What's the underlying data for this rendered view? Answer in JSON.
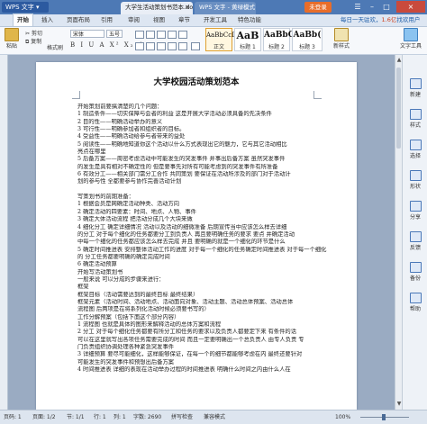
{
  "titlebar": {
    "app_name": "WPS 文字",
    "tabs": [
      {
        "label": "大学生活动策划书范本.doc *",
        "active": true
      },
      {
        "label": "WPS 文字 - 黄绿模式",
        "active": false
      }
    ],
    "login_label": "未登录",
    "controls": {
      "minimize": "–",
      "maximize": "□",
      "close": "×"
    }
  },
  "menubar": {
    "items": [
      "开始",
      "插入",
      "页面布局",
      "引用",
      "审阅",
      "视图",
      "章节",
      "开发工具",
      "特色功能"
    ],
    "promo_prefix": "每日一天驻欢，",
    "promo_highlight": "1.6亿",
    "promo_suffix": "找欢用户"
  },
  "ribbon": {
    "paste_label": "粘贴",
    "cut_label": "剪切",
    "copy_label": "复制",
    "format_painter_label": "格式刷",
    "font_name": "宋体",
    "font_size": "五号",
    "format_glyphs": "B I U A X² X₂ A",
    "styles": [
      {
        "sample": "AaBbCcDd",
        "name": "正文"
      },
      {
        "sample": "AaB",
        "name": "标题 1"
      },
      {
        "sample": "AaBbC",
        "name": "标题 2"
      },
      {
        "sample": "AaBb(",
        "name": "标题 3"
      }
    ],
    "new_style_label": "新样式",
    "text_tools_label": "文字工具"
  },
  "document": {
    "title": "大学校园活动策划范本",
    "lines": [
      "开始策划前要搞清楚的几个问题：",
      "1 制造条件——切实保障与会者的利益 这是开展大学活动必须具备的先决条件",
      "2 目的性——明确活动举办的意义",
      "3 可行性——明确参加者和组织者的目标。",
      "4 受益性——明确活动给参与者带来的益处",
      "5 阅读性——明确地知道你这个活动以什么方式表现出它的魅力，它与其它活动相比",
      "亮点在哪里",
      "5 后备方案——周密考虑活动中可能发生的突发事件 并事出后备方案 虽然突发事件",
      "的发生是具有相对不确定性的 但是要事先对所有可能考虑到的突发事件有所准备",
      "6 有效分工——相关部门需分工合作 共同策划 要保证在活动所涉及的部门对于活动计",
      "划的参与性 全都要参与协作完善活动计划",
      "",
      "写策划书的前期准备：",
      "1 根据会员是网确定活动种类、活动方向",
      "2 确定活动的四要素：时间、地点、人物、事件",
      "3 确定大体活动流程 把活动分成几个大块来做",
      "4 细化分工 确定详细情况 活动以及活动的细微准备 后期宣传当中应该怎么样去详细",
      "的分工 对于每个细化的任务都要分工到负责人 再且要明确任务的要求 要点 并确定活动",
      "中每一个细化的任务都应该怎么样去完成 并且 要明确的就是一个细化的环节是什么",
      "5 确定时间推进表 安排整体活动工作的进度 对于每一个细化的任务确定时间推进表 对于每一个细化",
      "的 分工任务都要明确的确定完成时间",
      "6 确定活动预算",
      "开始写活动策划书",
      "一般来说 可以分成的步骤来进行：",
      "框架",
      "框架目标（活动需要达到的最终目标 最终结果）",
      "框架元素（活动时间、活动地点、活动面向对象、活动主题、活动总体预案、活动总体",
      "流程图 后两项是在将系列化活动时候必须要书写的）",
      "工作分解预案（包括下面这个部分内容）",
      "1 流程图 也就是具体的图形来解释活动的总体方案和流程",
      "2 分工 对于每个细化任务都要有所分工和任务的要求以及负责人都要定下来 有条件的话",
      "可以在这里就写出各项任务需要完成的时间 而且一定要明确出一个总负责人 由专人负责 专",
      "门负责组织协调处理各种紧急突发事件",
      "3 详细预算 要尽可能细化，这样能够保证，在每一个的细节都能够考虑在内 最终还要针对",
      "可能发生的突发事件和预想出后备方案",
      "4 时间推进表 详细的表现在活动举办过程的时间推进表 明确什么时间之内由什么人在"
    ]
  },
  "sidebar": {
    "items": [
      "新建",
      "样式",
      "选择",
      "形状",
      "分享",
      "反馈",
      "备份",
      "帮助"
    ]
  },
  "statusbar": {
    "page_info": "页码: 1",
    "pages": "页面: 1/2",
    "section": "节: 1/1",
    "row": "行: 1",
    "column": "列: 1",
    "word_count": "字数: 2690",
    "spell_check": "拼写检查",
    "mode": "兼容模式",
    "zoom": "100%"
  }
}
